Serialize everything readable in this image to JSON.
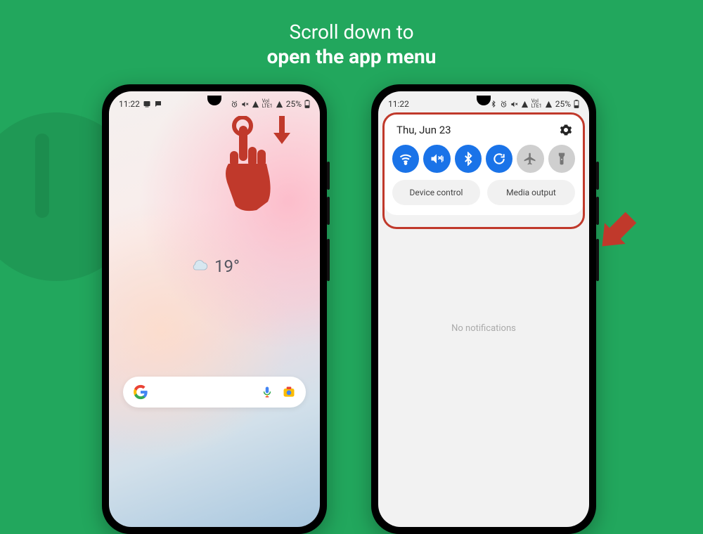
{
  "headline": {
    "line1": "Scroll down to",
    "line2": "open the app menu"
  },
  "statusbar": {
    "time": "11:22",
    "battery_pct": "25%"
  },
  "home": {
    "temperature": "19°"
  },
  "shade": {
    "date": "Thu, Jun 23",
    "tiles": {
      "wifi": "wifi-icon",
      "mute": "mute-icon",
      "bluetooth": "bluetooth-icon",
      "sync": "sync-icon",
      "airplane": "airplane-icon",
      "flashlight": "flashlight-icon"
    },
    "buttons": {
      "device_control": "Device control",
      "media_output": "Media output"
    },
    "empty_text": "No notifications"
  }
}
